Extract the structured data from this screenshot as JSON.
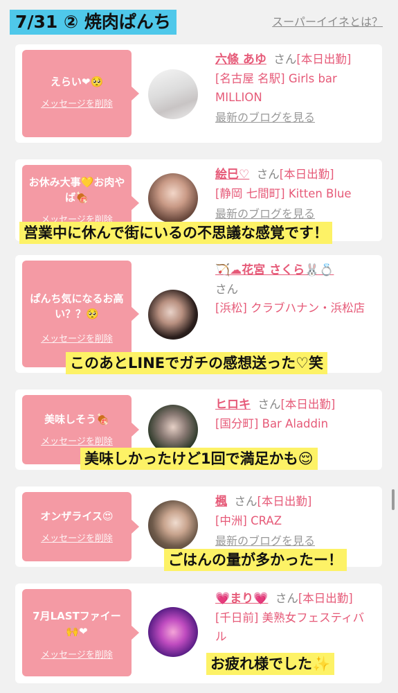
{
  "header": {
    "title": "7/31 ② 焼肉ぱんち",
    "help_link": "スーパーイイネとは？"
  },
  "cards": [
    {
      "message": "えらい❤🥺",
      "delete_label": "メッセージを削除",
      "name": "六條 あゆ",
      "honorific": "さん",
      "status": "[本日出勤]",
      "shop": "[名古屋 名駅] Girls bar MILLION",
      "blog_link": "最新のブログを見る",
      "caption": ""
    },
    {
      "message": "お休み大事💛お肉やば🍖",
      "delete_label": "メッセージを削除",
      "name": "絵巳♡",
      "honorific": "さん",
      "status": "[本日出勤]",
      "shop": "[静岡 七間町] Kitten Blue",
      "blog_link": "最新のブログを見る",
      "caption": "営業中に休んで街にいるの不思議な感覚です！"
    },
    {
      "message": "ぱんち気になるお高い？？🥺",
      "delete_label": "メッセージを削除",
      "name": "🏹☁花宮 さくら🐰💍",
      "honorific": "さん",
      "status": "",
      "shop": "[浜松] クラブハナン・浜松店",
      "blog_link": "",
      "caption": "このあとLINEでガチの感想送った♡笑"
    },
    {
      "message": "美味しそう🍖",
      "delete_label": "メッセージを削除",
      "name": "ヒロキ",
      "honorific": "さん",
      "status": "[本日出勤]",
      "shop": "[国分町] Bar Aladdin",
      "blog_link": "",
      "caption": "美味しかったけど1回で満足かも😌"
    },
    {
      "message": "オンザライス😍",
      "delete_label": "メッセージを削除",
      "name": "楓",
      "honorific": "さん",
      "status": "[本日出勤]",
      "shop": "[中洲] CRAZ",
      "blog_link": "最新のブログを見る",
      "caption": "ごはんの量が多かったー！"
    },
    {
      "message": "7月LASTファイー🙌❤",
      "delete_label": "メッセージを削除",
      "name": "💗まり💗",
      "honorific": "さん",
      "status": "[本日出勤]",
      "shop": "[千日前] 美熟女フェスティバル",
      "blog_link": "",
      "caption": "お疲れ様でした✨"
    }
  ],
  "colors": {
    "title_bg": "#4fc8ea",
    "bubble": "#f49aa4",
    "accent": "#e65a78",
    "caption_bg": "#fdf266"
  }
}
